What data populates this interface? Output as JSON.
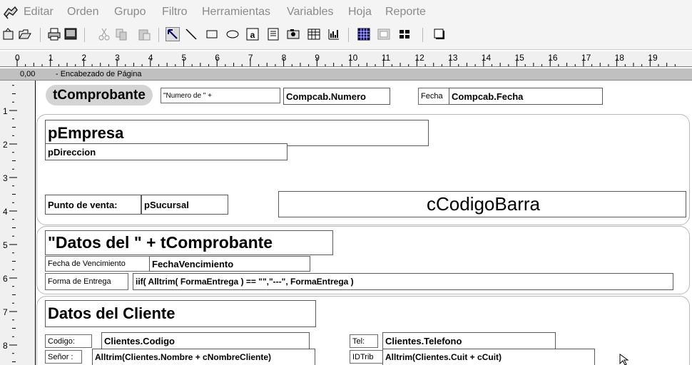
{
  "menu": {
    "items": [
      "Editar",
      "Orden",
      "Grupo",
      "Filtro",
      "Herramientas",
      "Variables",
      "Hoja",
      "Reporte"
    ]
  },
  "toolbar": {
    "buttons": [
      "new-icon",
      "open-icon",
      "print-icon",
      "preview-icon",
      "cut-icon",
      "copy-icon",
      "paste-icon",
      "pointer-tool-icon",
      "line-tool-icon",
      "rectangle-tool-icon",
      "ellipse-tool-icon",
      "field-tool-icon",
      "text-tool-icon",
      "picture-tool-icon",
      "table-tool-icon",
      "chart-tool-icon",
      "grid-icon",
      "layout-icon",
      "page-icon",
      "shadow-box-icon"
    ]
  },
  "ruler": {
    "labels": [
      "0",
      "1",
      "2",
      "3",
      "4",
      "5",
      "6",
      "7",
      "8",
      "9",
      "10",
      "11",
      "12",
      "13",
      "14",
      "15",
      "16",
      "17",
      "18",
      "19"
    ],
    "vlabels": [
      "1",
      "2",
      "3",
      "4",
      "5",
      "6",
      "7",
      "8"
    ]
  },
  "band": {
    "position": "0,00",
    "title": "- Encabezado de Página"
  },
  "report": {
    "comprobante": "tComprobante",
    "numero_label": "\"Numero de \" +",
    "numero_value": "Compcab.Numero",
    "fecha_label": "Fecha",
    "fecha_value": "Compcab.Fecha",
    "empresa": "pEmpresa",
    "direccion": "pDireccion",
    "punto_venta_label": "Punto de venta:",
    "sucursal": "pSucursal",
    "codigo_barra": "cCodigoBarra",
    "datos_title": "\"Datos del \" + tComprobante",
    "vencimiento_label": "Fecha de Vencimiento",
    "vencimiento_value": "FechaVencimiento",
    "entrega_label": "Forma de Entrega",
    "entrega_value": "iif( Alltrim( FormaEntrega ) == \"\",\"---\", FormaEntrega )",
    "cliente_title": "Datos del Cliente",
    "codigo_label": "Codigo:",
    "codigo_value": "Clientes.Codigo",
    "tel_label": "Tel:",
    "tel_value": "Clientes.Telefono",
    "senor_label": "Señor :",
    "senor_value": "Alltrim(Clientes.Nombre + cNombreCliente)",
    "idtrib_label": "IDTrib",
    "idtrib_value": "Alltrim(Clientes.Cuit + cCuit)"
  }
}
